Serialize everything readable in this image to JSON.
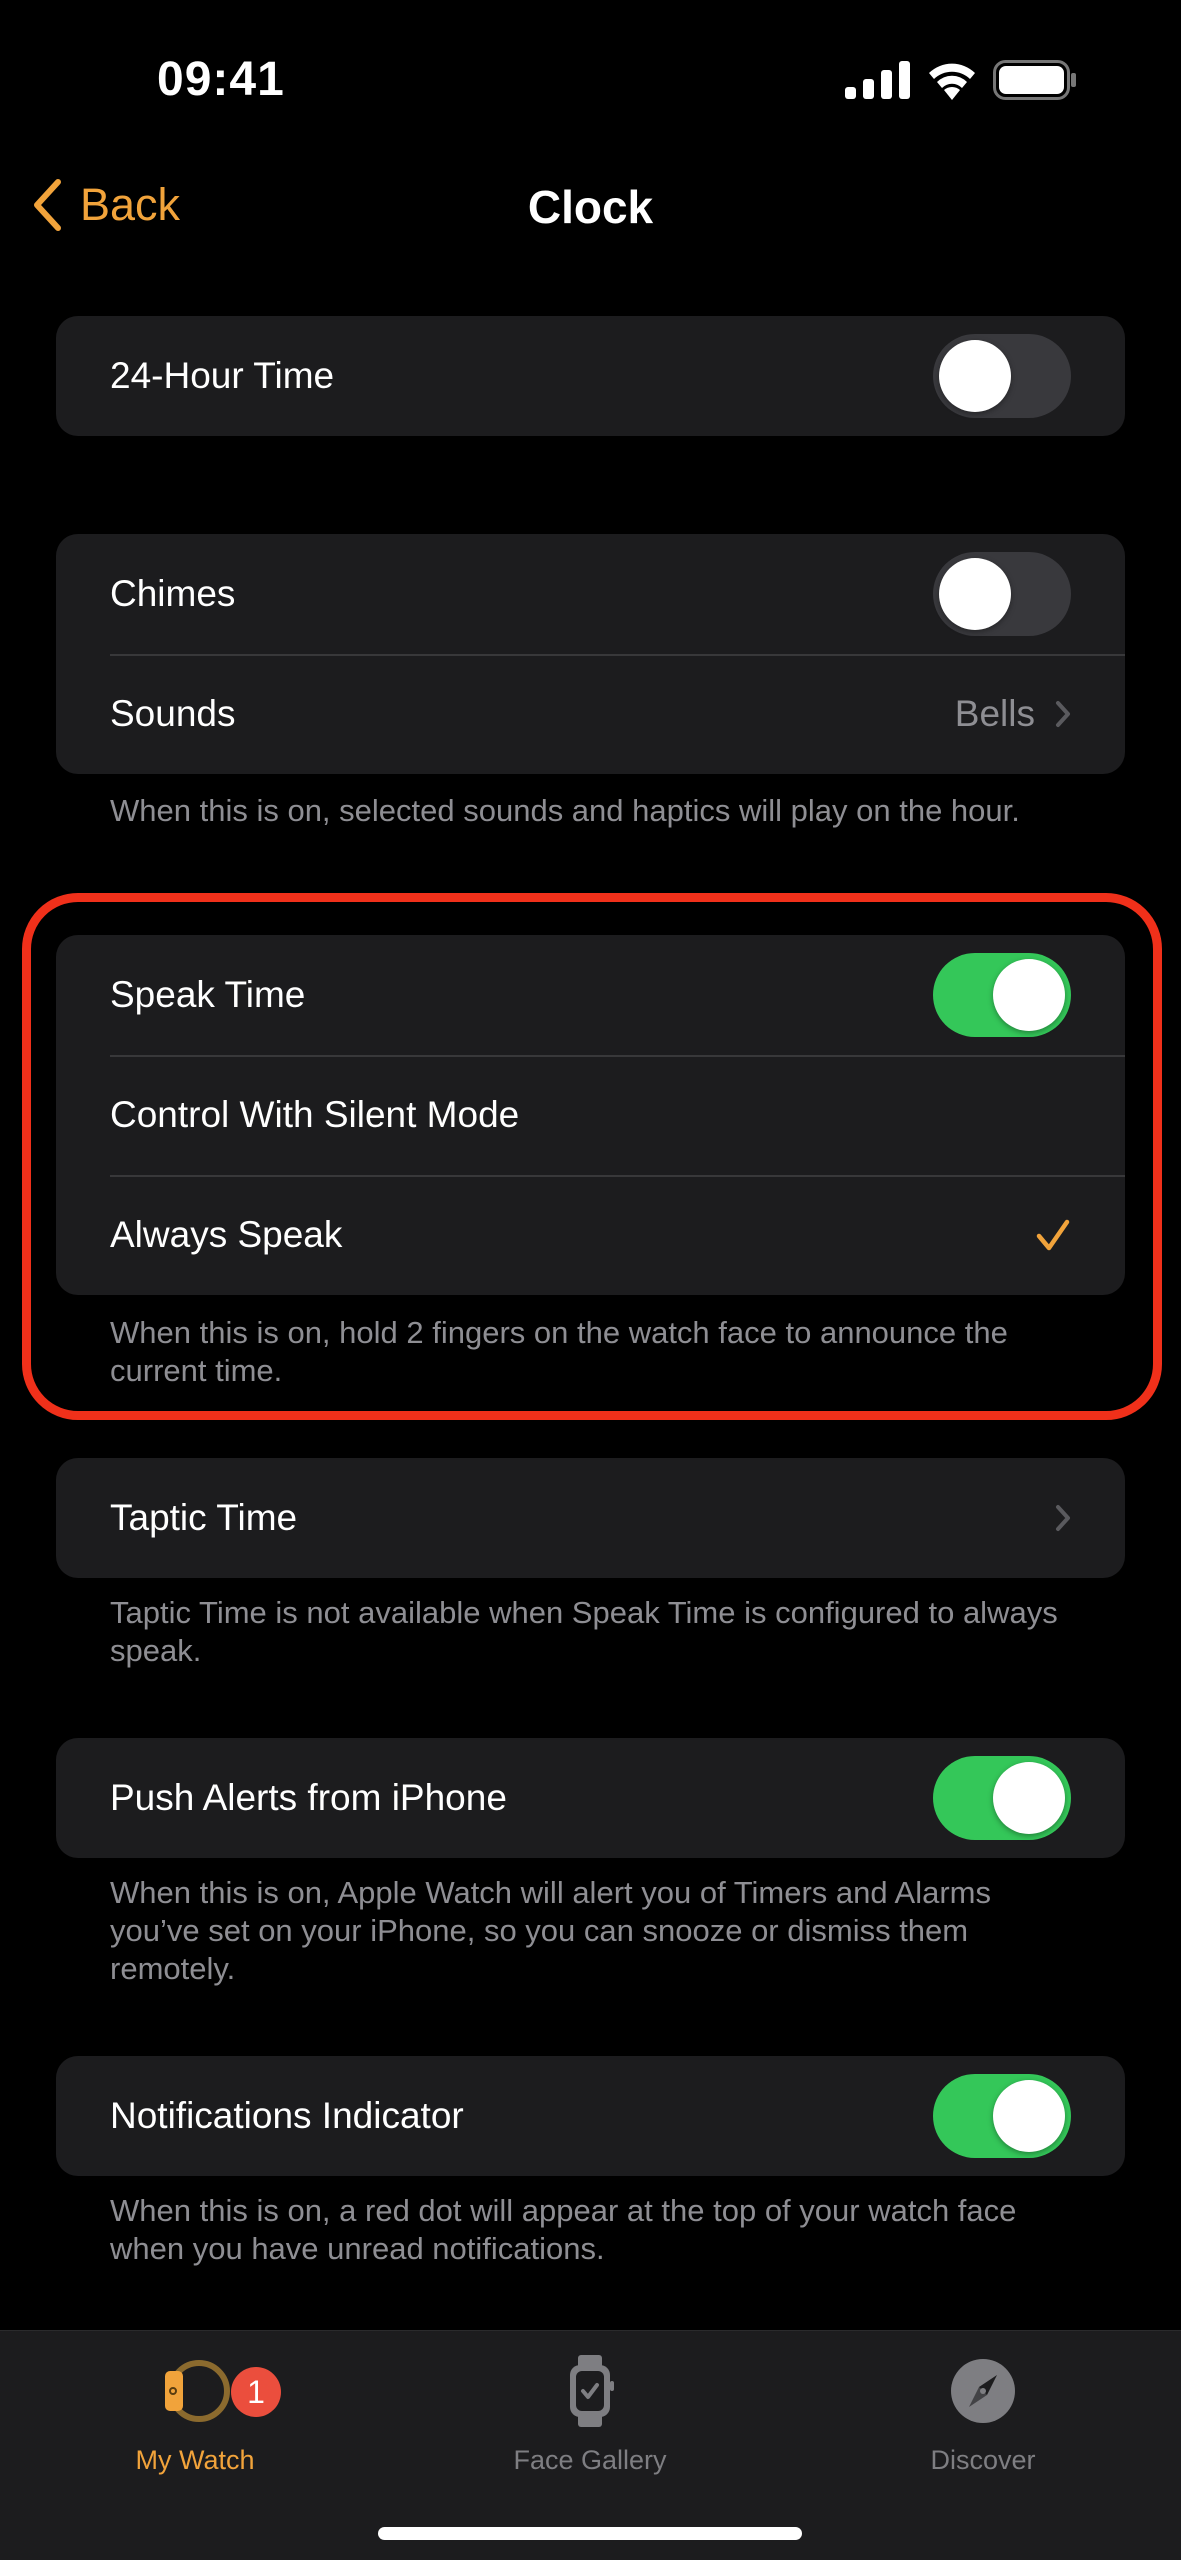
{
  "status_bar": {
    "time": "09:41",
    "icons": [
      "cellular-signal-icon",
      "wifi-icon",
      "battery-icon"
    ]
  },
  "nav": {
    "back_label": "Back",
    "title": "Clock"
  },
  "accent_color": "#F1A33B",
  "sections": {
    "hour_time": {
      "label": "24-Hour Time",
      "toggle_on": false
    },
    "chimes": {
      "chimes_label": "Chimes",
      "chimes_on": false,
      "sounds_label": "Sounds",
      "sounds_value": "Bells",
      "footer": "When this is on, selected sounds and haptics will play on the hour."
    },
    "speak_time": {
      "label": "Speak Time",
      "toggle_on": true,
      "options": [
        {
          "label": "Control With Silent Mode",
          "selected": false
        },
        {
          "label": "Always Speak",
          "selected": true
        }
      ],
      "footer": "When this is on, hold 2 fingers on the watch face to announce the current time."
    },
    "taptic_time": {
      "label": "Taptic Time",
      "footer": "Taptic Time is not available when Speak Time is configured to always speak."
    },
    "push_alerts": {
      "label": "Push Alerts from iPhone",
      "toggle_on": true,
      "footer": "When this is on, Apple Watch will alert you of Timers and Alarms you’ve set on your iPhone, so you can snooze or dismiss them remotely."
    },
    "notifications_indicator": {
      "label": "Notifications Indicator",
      "toggle_on": true,
      "footer": "When this is on, a red dot will appear at the top of your watch face when you have unread notifications."
    }
  },
  "tab_bar": {
    "tabs": [
      {
        "label": "My Watch",
        "icon": "my-watch-icon",
        "active": true,
        "badge": "1"
      },
      {
        "label": "Face Gallery",
        "icon": "face-gallery-icon",
        "active": false
      },
      {
        "label": "Discover",
        "icon": "compass-icon",
        "active": false
      }
    ]
  }
}
